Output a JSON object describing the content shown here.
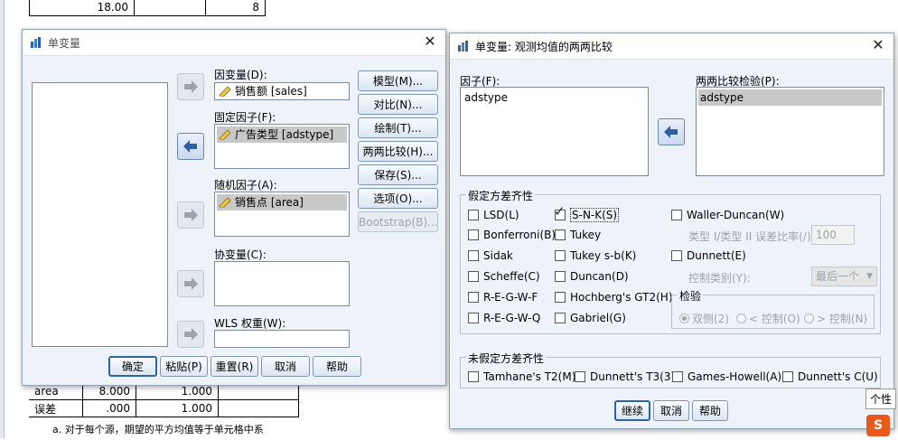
{
  "background": {
    "top_row": [
      "18.00",
      "",
      "8"
    ],
    "rows": [
      {
        "label": "area",
        "c1": "8.000",
        "c2": "1.000"
      },
      {
        "label": "误差",
        "c1": ".000",
        "c2": "1.000"
      }
    ],
    "footnote1": "a. 对于每个源，期望的平方均值等于单元格中系",
    "footnote2": "……………………………………………"
  },
  "univariate": {
    "title": "单变量",
    "dependent_label": "因变量(D):",
    "dependent_item": "销售额 [sales]",
    "fixed_label": "固定因子(F):",
    "fixed_item": "广告类型 [adstype]",
    "random_label": "随机因子(A):",
    "random_item": "销售点 [area]",
    "covariate_label": "协变量(C):",
    "wls_label": "WLS 权重(W):",
    "side_buttons": [
      "模型(M)...",
      "对比(N)...",
      "绘制(T)...",
      "两两比较(H)...",
      "保存(S)...",
      "选项(O)...",
      "Bootstrap(B)..."
    ],
    "bottom_buttons": {
      "ok": "确定",
      "paste": "粘贴(P)",
      "reset": "重置(R)",
      "cancel": "取消",
      "help": "帮助"
    }
  },
  "posthoc": {
    "title": "单变量: 观测均值的两两比较",
    "factors_label": "因子(F):",
    "factors": [
      "adstype"
    ],
    "tests_label": "两两比较检验(P):",
    "tests": [
      "adstype"
    ],
    "equal_group_title": "假定方差齐性",
    "equal_col1": [
      {
        "label": "LSD(L)",
        "checked": false
      },
      {
        "label": "Bonferroni(B)",
        "checked": false
      },
      {
        "label": "Sidak",
        "checked": false
      },
      {
        "label": "Scheffe(C)",
        "checked": false
      },
      {
        "label": "R-E-G-W-F",
        "checked": false
      },
      {
        "label": "R-E-G-W-Q",
        "checked": false
      }
    ],
    "equal_col2": [
      {
        "label": "S-N-K(S)",
        "checked": true
      },
      {
        "label": "Tukey",
        "checked": false
      },
      {
        "label": "Tukey s-b(K)",
        "checked": false
      },
      {
        "label": "Duncan(D)",
        "checked": false
      },
      {
        "label": "Hochberg's GT2(H)",
        "checked": false
      },
      {
        "label": "Gabriel(G)",
        "checked": false
      }
    ],
    "waller": "Waller-Duncan(W)",
    "ratio_label": "类型 I/类型 II 误差比率(/):",
    "ratio_value": "100",
    "dunnett": "Dunnett(E)",
    "control_label": "控制类别(Y):",
    "control_value": "最后一个",
    "test_group_title": "检验",
    "test_radios": [
      "双侧(2)",
      "< 控制(O)",
      "> 控制(N)"
    ],
    "unequal_group_title": "未假定方差齐性",
    "unequal": [
      "Tamhane's T2(M)",
      "Dunnett's T3(3)",
      "Games-Howell(A)",
      "Dunnett's C(U)"
    ],
    "buttons": {
      "continue": "继续",
      "cancel": "取消",
      "help": "帮助"
    }
  },
  "tooltip": "个性",
  "sogou_icon": "S"
}
